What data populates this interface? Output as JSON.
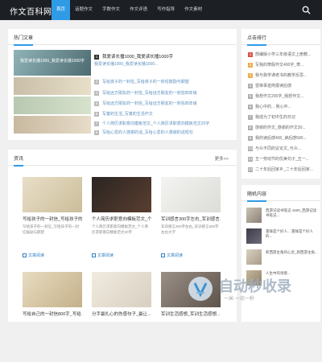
{
  "header": {
    "logo": "作文百科网",
    "nav": [
      "首页",
      "话题作文",
      "字数作文",
      "作文评语",
      "写作指导",
      "作文素材"
    ]
  },
  "hot_articles": {
    "title": "热门文章",
    "featured_image_text": "我爱读长播1000_我爱读长播1000字",
    "items": [
      {
        "num": "1",
        "text": "我爱读长播1000_我爱读长播1000字"
      },
      {
        "num": "2",
        "text": "我爱读长播1000_我爱读长播1000..."
      },
      {
        "num": "3",
        "text": "写给孩子的一封信_写给孩子的一封信鼓励与期望"
      },
      {
        "num": "4",
        "text": "写给远方朋友的一封信_写给远方朋友的一封信四年级"
      },
      {
        "num": "5",
        "text": "写给远方朋友的一封信_写给远方朋友的一封信四年级"
      },
      {
        "num": "6",
        "text": "写童的生活_写童的生活作文"
      },
      {
        "num": "7",
        "text": "个人简历求职意向模板范文_个人简历求职意向模板范文20字"
      },
      {
        "num": "8",
        "text": "写给心爱的人感谢的话_写给心爱的人感谢的话短句"
      }
    ]
  },
  "recommend": {
    "title": "点击排行",
    "items": [
      {
        "num": "1",
        "text": "部编版小学三年级语文上册教..."
      },
      {
        "num": "2",
        "text": "写我的寒假作文400字_寒..."
      },
      {
        "num": "3",
        "text": "我与我学课老书的教学反思..."
      },
      {
        "num": "4",
        "text": "雷锋事迹简报读后感"
      },
      {
        "num": "5",
        "text": "我想作文200字_我想作文..."
      },
      {
        "num": "6",
        "text": "我心中的... 我心中..."
      },
      {
        "num": "7",
        "text": "我成为了初中生的日记"
      },
      {
        "num": "8",
        "text": "感谢的作文_感谢的作文30..."
      },
      {
        "num": "9",
        "text": "我的读后感400_读后感500..."
      },
      {
        "num": "10",
        "text": "与众不同的议论文_与众..."
      },
      {
        "num": "11",
        "text": "五一劳动节的优美句子_五一..."
      },
      {
        "num": "12",
        "text": "二十年后回家乡_二十年后回家..."
      }
    ]
  },
  "random": {
    "title": "随机内容",
    "items": [
      {
        "text": "西游记读书笔记 1500_西游记读书笔记..."
      },
      {
        "text": "雷锋是个好人... 雷锋是个好人的..."
      },
      {
        "text": "新西游主角的心灵_新西游主角..."
      },
      {
        "text": "人生中的诗意..."
      }
    ]
  },
  "essays": {
    "title": "资讯",
    "more": "更多>>",
    "cards": [
      {
        "title": "写给孩子的一封信_写给孩子的一...",
        "desc": "写给孩子的一封信_写给孩子的一封信鼓励与期望",
        "tag": "文章阅读"
      },
      {
        "title": "个人简历求职意向模板范文_个人...",
        "desc": "个人简历求职意向模板范文_个人简历求职意向模板范文20字",
        "tag": "文章阅读"
      },
      {
        "title": "军训感言300字左右_军训感言...",
        "desc": "军训感言300字左右_军训感言300字左右大学",
        "tag": "文章阅读"
      },
      {
        "title": "写给自己的一封信800字_写给...",
        "desc": "",
        "tag": ""
      },
      {
        "title": "分手最扎心的伤感句子_最让...",
        "desc": "",
        "tag": ""
      },
      {
        "title": "军训生活感想_军训生活感想...",
        "desc": "",
        "tag": ""
      }
    ]
  },
  "watermark": {
    "main": "自动秒收录",
    "sub": "一米·一坊一秒"
  },
  "colors": {
    "accent": "#2f9be6",
    "topbar": "#1c1f24",
    "hot_red": "#d9534f",
    "hot_orange": "#f0ad4e"
  }
}
